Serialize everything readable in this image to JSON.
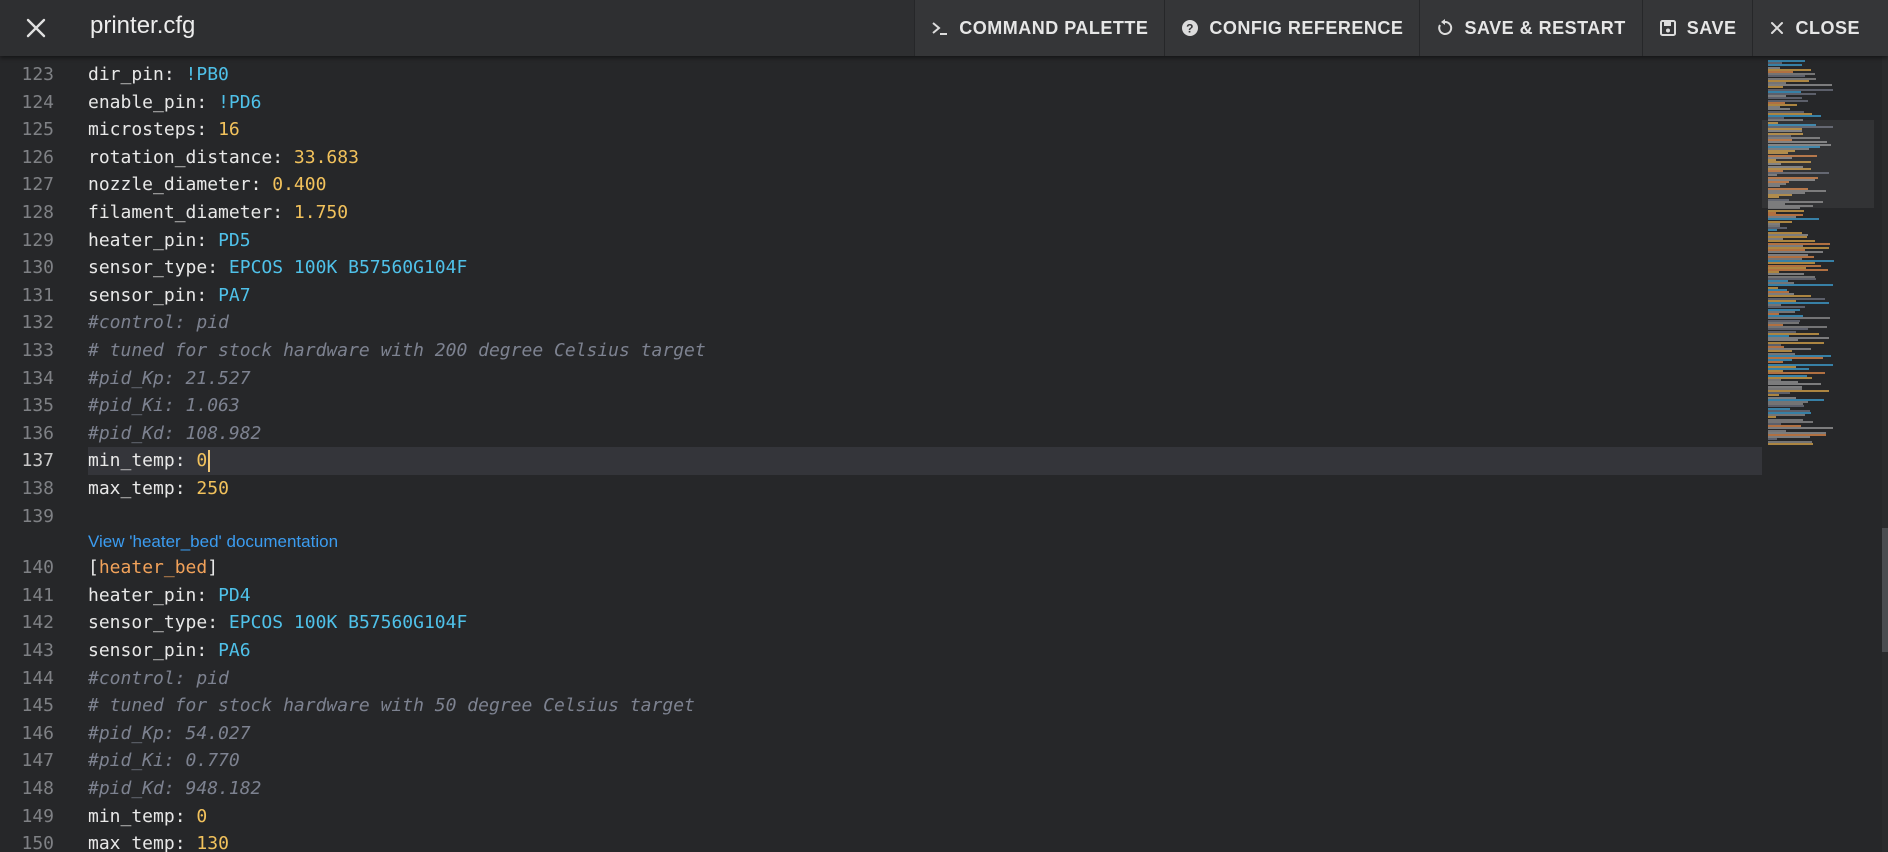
{
  "header": {
    "close_icon": "close-icon",
    "title": "printer.cfg",
    "actions": [
      {
        "label": "COMMAND PALETTE",
        "icon": "terminal-icon"
      },
      {
        "label": "CONFIG REFERENCE",
        "icon": "help-circle-icon"
      },
      {
        "label": "SAVE & RESTART",
        "icon": "restart-icon"
      },
      {
        "label": "SAVE",
        "icon": "floppy-icon"
      },
      {
        "label": "CLOSE",
        "icon": "close-icon"
      }
    ]
  },
  "editor": {
    "lines": [
      {
        "n": "123",
        "key": "dir_pin",
        "val": "!PB0",
        "type": "pin"
      },
      {
        "n": "124",
        "key": "enable_pin",
        "val": "!PD6",
        "type": "pin"
      },
      {
        "n": "125",
        "key": "microsteps",
        "val": "16",
        "type": "num"
      },
      {
        "n": "126",
        "key": "rotation_distance",
        "val": "33.683",
        "type": "num"
      },
      {
        "n": "127",
        "key": "nozzle_diameter",
        "val": "0.400",
        "type": "num"
      },
      {
        "n": "128",
        "key": "filament_diameter",
        "val": "1.750",
        "type": "num"
      },
      {
        "n": "129",
        "key": "heater_pin",
        "val": "PD5",
        "type": "pin"
      },
      {
        "n": "130",
        "key": "sensor_type",
        "val": "EPCOS 100K B57560G104F",
        "type": "str"
      },
      {
        "n": "131",
        "key": "sensor_pin",
        "val": "PA7",
        "type": "pin"
      },
      {
        "n": "132",
        "comment": "#control: pid"
      },
      {
        "n": "133",
        "comment": "# tuned for stock hardware with 200 degree Celsius target"
      },
      {
        "n": "134",
        "comment": "#pid_Kp: 21.527"
      },
      {
        "n": "135",
        "comment": "#pid_Ki: 1.063"
      },
      {
        "n": "136",
        "comment": "#pid_Kd: 108.982"
      },
      {
        "n": "137",
        "key": "min_temp",
        "val": "0",
        "type": "num",
        "active": true
      },
      {
        "n": "138",
        "key": "max_temp",
        "val": "250",
        "type": "num"
      },
      {
        "n": "139",
        "empty": true
      },
      {
        "doclink": "View 'heater_bed' documentation"
      },
      {
        "n": "140",
        "section": "heater_bed"
      },
      {
        "n": "141",
        "key": "heater_pin",
        "val": "PD4",
        "type": "pin"
      },
      {
        "n": "142",
        "key": "sensor_type",
        "val": "EPCOS 100K B57560G104F",
        "type": "str"
      },
      {
        "n": "143",
        "key": "sensor_pin",
        "val": "PA6",
        "type": "pin"
      },
      {
        "n": "144",
        "comment": "#control: pid"
      },
      {
        "n": "145",
        "comment": "# tuned for stock hardware with 50 degree Celsius target"
      },
      {
        "n": "146",
        "comment": "#pid_Kp: 54.027"
      },
      {
        "n": "147",
        "comment": "#pid_Ki: 0.770"
      },
      {
        "n": "148",
        "comment": "#pid_Kd: 948.182"
      },
      {
        "n": "149",
        "key": "min_temp",
        "val": "0",
        "type": "num"
      },
      {
        "n": "150",
        "key": "max_temp",
        "val": "130",
        "type": "num"
      }
    ]
  },
  "colors": {
    "background": "#262729",
    "pin": "#4fc1e9",
    "number": "#f2c25c",
    "comment": "#7d8290",
    "section": "#f2a25a",
    "link": "#3b9cf0"
  }
}
